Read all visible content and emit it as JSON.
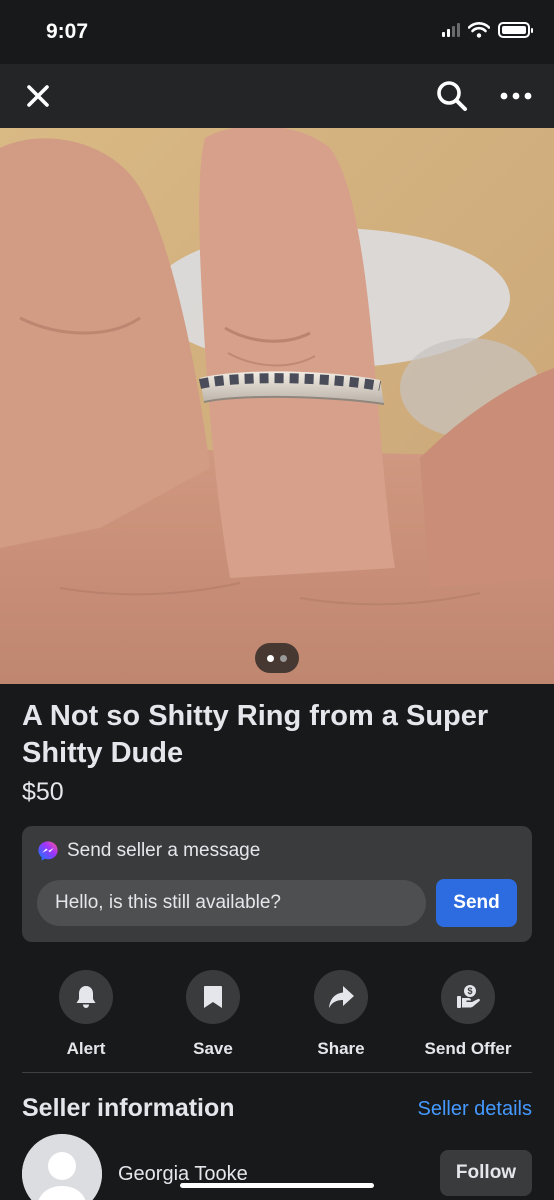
{
  "status_bar": {
    "time": "9:07"
  },
  "listing": {
    "title": "A Not so Shitty Ring from a Super Shitty Dude",
    "price": "$50",
    "photo_pager": {
      "count": 2,
      "active": 1
    }
  },
  "message": {
    "heading": "Send seller a message",
    "input_value": "Hello, is this still available?",
    "send_label": "Send"
  },
  "actions": [
    {
      "label": "Alert",
      "icon": "bell-icon"
    },
    {
      "label": "Save",
      "icon": "bookmark-icon"
    },
    {
      "label": "Share",
      "icon": "share-icon"
    },
    {
      "label": "Send Offer",
      "icon": "offer-icon"
    }
  ],
  "seller": {
    "heading": "Seller information",
    "details_link": "Seller details",
    "name": "Georgia Tooke",
    "follow_label": "Follow"
  },
  "colors": {
    "background": "#18191a",
    "card": "#3a3b3c",
    "accent": "#2d6be0",
    "link": "#4599ff"
  }
}
